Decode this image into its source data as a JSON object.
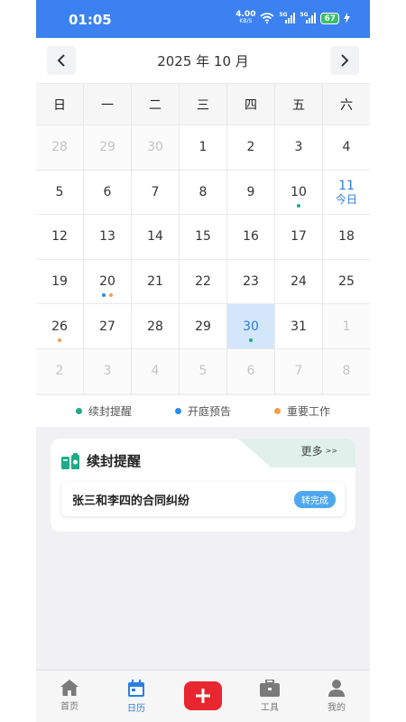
{
  "status_bar": {
    "time": "01:05",
    "net_speed": "4.00",
    "net_unit": "KB/S",
    "sig1_label": "5G",
    "sig2_label": "5G",
    "battery": "67"
  },
  "header": {
    "month_title": "2025 年 10 月"
  },
  "calendar": {
    "weekdays": [
      "日",
      "一",
      "二",
      "三",
      "四",
      "五",
      "六"
    ],
    "weeks": [
      [
        {
          "d": "28",
          "other": true
        },
        {
          "d": "29",
          "other": true
        },
        {
          "d": "30",
          "other": true
        },
        {
          "d": "1"
        },
        {
          "d": "2"
        },
        {
          "d": "3"
        },
        {
          "d": "4"
        }
      ],
      [
        {
          "d": "5"
        },
        {
          "d": "6"
        },
        {
          "d": "7"
        },
        {
          "d": "8"
        },
        {
          "d": "9"
        },
        {
          "d": "10",
          "dots": [
            "renewal"
          ]
        },
        {
          "d": "11",
          "today": true,
          "sub": "今日"
        }
      ],
      [
        {
          "d": "12"
        },
        {
          "d": "13"
        },
        {
          "d": "14"
        },
        {
          "d": "15"
        },
        {
          "d": "16"
        },
        {
          "d": "17"
        },
        {
          "d": "18"
        }
      ],
      [
        {
          "d": "19"
        },
        {
          "d": "20",
          "dots": [
            "hearing",
            "important"
          ]
        },
        {
          "d": "21"
        },
        {
          "d": "22"
        },
        {
          "d": "23"
        },
        {
          "d": "24"
        },
        {
          "d": "25"
        }
      ],
      [
        {
          "d": "26",
          "dots": [
            "important"
          ]
        },
        {
          "d": "27"
        },
        {
          "d": "28"
        },
        {
          "d": "29"
        },
        {
          "d": "30",
          "selected": true,
          "dots": [
            "renewal"
          ]
        },
        {
          "d": "31"
        },
        {
          "d": "1",
          "other": true
        }
      ],
      [
        {
          "d": "2",
          "other": true
        },
        {
          "d": "3",
          "other": true
        },
        {
          "d": "4",
          "other": true
        },
        {
          "d": "5",
          "other": true
        },
        {
          "d": "6",
          "other": true
        },
        {
          "d": "7",
          "other": true
        },
        {
          "d": "8",
          "other": true
        }
      ]
    ]
  },
  "legend": [
    {
      "key": "renewal",
      "label": "续封提醒",
      "color": "#1faa8a"
    },
    {
      "key": "hearing",
      "label": "开庭预告",
      "color": "#2b8ce6"
    },
    {
      "key": "important",
      "label": "重要工作",
      "color": "#f0a04b"
    }
  ],
  "card": {
    "title": "续封提醒",
    "more": "更多",
    "more_arrow": ">>",
    "item_text": "张三和李四的合同纠纷",
    "done_label": "转完成"
  },
  "nav": {
    "home": "首页",
    "calendar": "日历",
    "tools": "工具",
    "mine": "我的"
  },
  "colors": {
    "primary": "#3b82f0",
    "accent_red": "#e8262f",
    "selected_bg": "#d3e6fb"
  }
}
